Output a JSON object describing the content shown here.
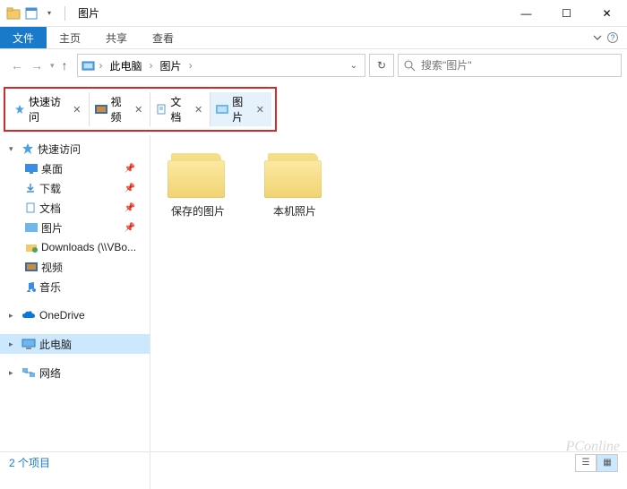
{
  "window": {
    "title": "图片",
    "controls": {
      "min": "—",
      "max": "☐",
      "close": "✕"
    }
  },
  "ribbon": {
    "file": "文件",
    "home": "主页",
    "share": "共享",
    "view": "查看"
  },
  "nav": {
    "crumb_root": "此电脑",
    "crumb_current": "图片"
  },
  "search": {
    "placeholder": "搜索\"图片\""
  },
  "tabs": [
    {
      "label": "快速访问",
      "icon": "star"
    },
    {
      "label": "视频",
      "icon": "video"
    },
    {
      "label": "文档",
      "icon": "doc"
    },
    {
      "label": "图片",
      "icon": "pic",
      "active": true
    }
  ],
  "sidebar": {
    "quick_access": "快速访问",
    "items": [
      {
        "label": "桌面",
        "icon": "desktop",
        "pinned": true
      },
      {
        "label": "下载",
        "icon": "download",
        "pinned": true
      },
      {
        "label": "文档",
        "icon": "doc",
        "pinned": true
      },
      {
        "label": "图片",
        "icon": "pic",
        "pinned": true
      },
      {
        "label": "Downloads (\\\\VBo...",
        "icon": "netfolder"
      },
      {
        "label": "视频",
        "icon": "video"
      },
      {
        "label": "音乐",
        "icon": "music"
      }
    ],
    "onedrive": "OneDrive",
    "this_pc": "此电脑",
    "network": "网络"
  },
  "content": {
    "folders": [
      {
        "label": "保存的图片"
      },
      {
        "label": "本机照片"
      }
    ]
  },
  "status": {
    "count_text": "2 个项目"
  },
  "watermark": "PConline"
}
